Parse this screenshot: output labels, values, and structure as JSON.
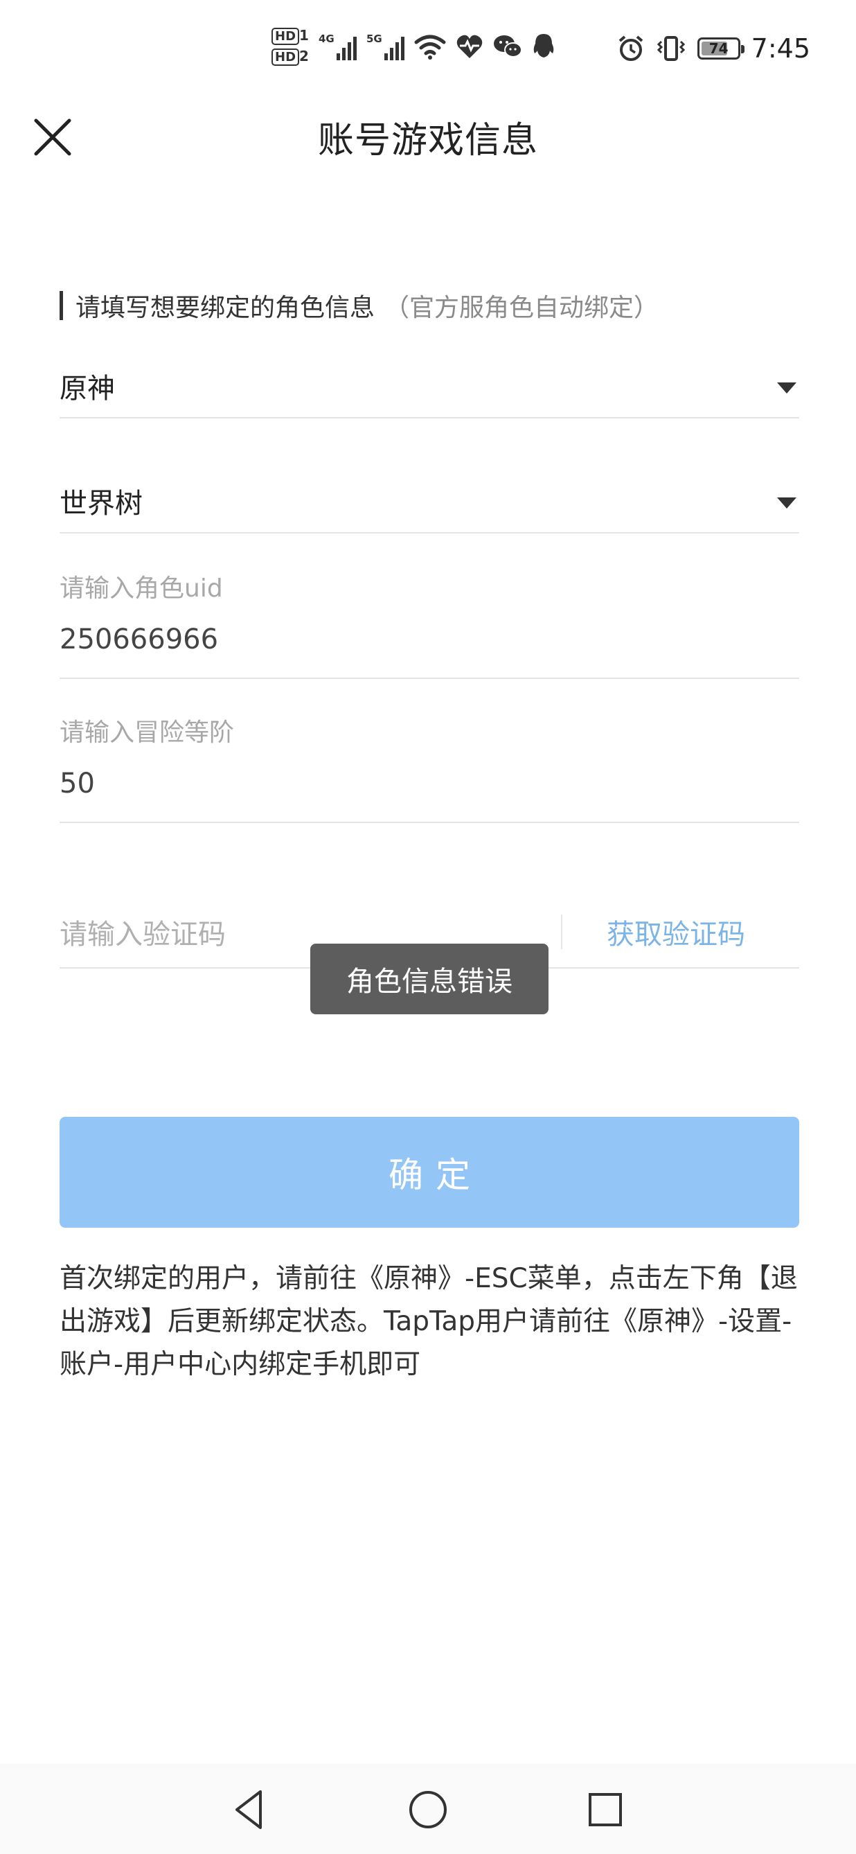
{
  "status_bar": {
    "hd1": "HD",
    "hd1_sub": "1",
    "hd2": "HD",
    "hd2_sub": "2",
    "sim1_net": "4G",
    "sim2_net": "5G",
    "battery": "74",
    "battery_level": 0.74,
    "time": "7:45",
    "icons": [
      "wifi-icon",
      "heart-pulse-icon",
      "wechat-icon",
      "qq-icon",
      "alarm-icon",
      "vibrate-icon"
    ]
  },
  "header": {
    "title": "账号游戏信息",
    "close_icon": "close-icon"
  },
  "form": {
    "section_label": "请填写想要绑定的角色信息",
    "section_note": "（官方服角色自动绑定）",
    "game_select": "原神",
    "server_select": "世界树",
    "uid_label": "请输入角色uid",
    "uid_value": "250666966",
    "rank_label": "请输入冒险等阶",
    "rank_value": "50",
    "code_placeholder": "请输入验证码",
    "get_code_label": "获取验证码",
    "confirm_label": "确定"
  },
  "toast": {
    "message": "角色信息错误"
  },
  "notice": {
    "text": "首次绑定的用户，请前往《原神》-ESC菜单，点击左下角【退出游戏】后更新绑定状态。TapTap用户请前往《原神》-设置-账户-用户中心内绑定手机即可"
  },
  "navbar": {
    "icons": [
      "back-icon",
      "home-icon",
      "recents-icon"
    ]
  },
  "colors": {
    "accent": "#93c6f6",
    "link": "#7cb4e6",
    "toast_bg": "#5d5d5d"
  }
}
